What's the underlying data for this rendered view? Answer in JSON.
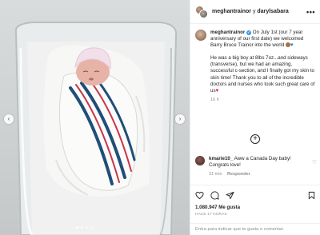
{
  "post": {
    "carousel": {
      "prev_icon": "chevron-left-icon",
      "next_icon": "chevron-right-icon",
      "slide_count": 4,
      "active_slide": 1
    },
    "header": {
      "account_1": "meghantrainor",
      "separator": "y",
      "account_2": "darylsabara",
      "more_icon": "more-horizontal-icon"
    },
    "caption": {
      "username": "meghantrainor",
      "paragraph_1": "On July 1st (our 7 year anniversary of our first date) we welcomed Barry Bruce Trainor into the world",
      "paragraph_2": "He was a big boy at 8lbs 7oz...and sideways (transverse), but we had an amazing, successful c-section, and I finally got my skin to skin time! Thank you to all of the incredible doctors and nurses who took such great care of us",
      "time": "16 h"
    },
    "load_more_icon": "plus-circle-icon",
    "comments": [
      {
        "username": "kmarie10_",
        "text": "Aww a Canada Day baby! Congrats love!",
        "time": "31 min",
        "reply_label": "Responder"
      }
    ],
    "actions": {
      "likes": "1.080.947 Me gusta",
      "posted_ago": "HACE 17 HORAS"
    },
    "comment_input": {
      "placeholder": "Entra para indicar que te gusta o comentar."
    },
    "colors": {
      "verified": "#3897f0",
      "border": "#efefef",
      "muted": "#8e8e8e",
      "stripe_navy": "#1f4e7a",
      "stripe_red": "#c8364a"
    }
  }
}
